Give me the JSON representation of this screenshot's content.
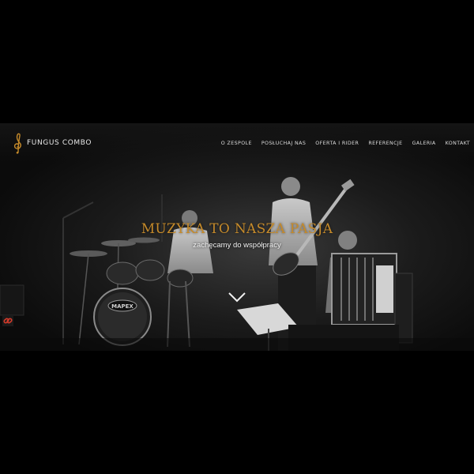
{
  "brand": {
    "name": "FUNGUS COMBO",
    "logo_icon": "treble-clef-logo-icon"
  },
  "nav": {
    "items": [
      {
        "label": "O ZESPOLE"
      },
      {
        "label": "POSŁUCHAJ NAS"
      },
      {
        "label": "OFERTA I RIDER"
      },
      {
        "label": "REFERENCJE"
      },
      {
        "label": "GALERIA"
      },
      {
        "label": "KONTAKT"
      }
    ]
  },
  "hero": {
    "title": "MUZYKA TO NASZA PASJA",
    "subtitle": "zachęcamy do współpracy",
    "scroll_icon": "chevron-down-icon",
    "drum_brand": "MAPEX"
  },
  "colors": {
    "accent": "#c58a2a",
    "background": "#000000",
    "text": "#f2f2f2"
  }
}
